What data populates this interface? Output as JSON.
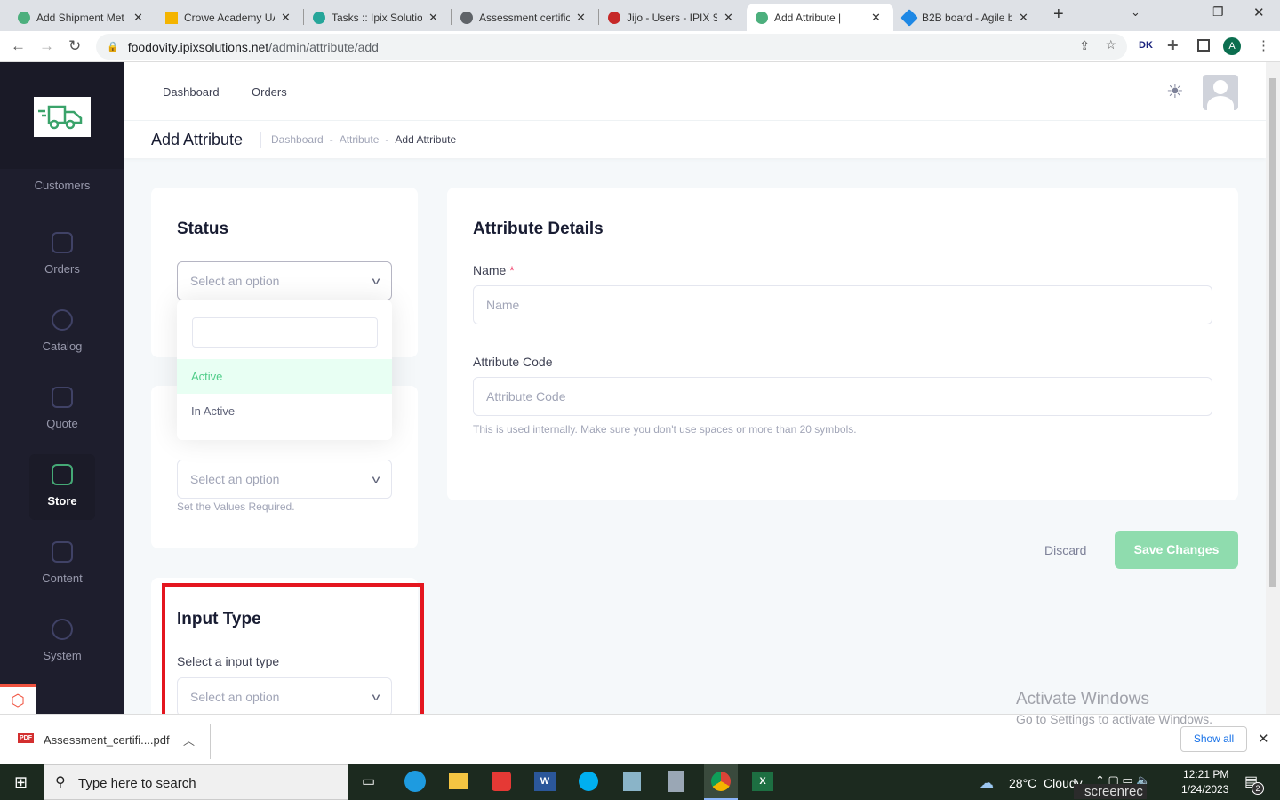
{
  "browser": {
    "tabs": [
      {
        "title": "Add Shipment Met",
        "color": "#4caf7d"
      },
      {
        "title": "Crowe Academy UA",
        "color": "#f4b400"
      },
      {
        "title": "Tasks :: Ipix Solution",
        "color": "#26a69a"
      },
      {
        "title": "Assessment certific",
        "color": "#5f6368"
      },
      {
        "title": "Jijo - Users - IPIX Sc",
        "color": "#c62828"
      },
      {
        "title": "Add Attribute |",
        "color": "#4caf7d"
      },
      {
        "title": "B2B board - Agile b",
        "color": "#1e88e5"
      }
    ],
    "active_tab": 5,
    "url_host": "foodovity.ipixsolutions.net",
    "url_path": "/admin/attribute/add",
    "profile": "A",
    "ext": "DK"
  },
  "sidebar": {
    "items": [
      "Customers",
      "Orders",
      "Catalog",
      "Quote",
      "Store",
      "Content",
      "System"
    ],
    "active": "Store"
  },
  "header": {
    "links": [
      "Dashboard",
      "Orders"
    ]
  },
  "toolbar": {
    "title": "Add Attribute",
    "breadcrumb": [
      "Dashboard",
      "Attribute",
      "Add Attribute"
    ]
  },
  "status_card": {
    "title": "Status",
    "placeholder": "Select an option",
    "search_value": "",
    "options": [
      "Active",
      "In Active"
    ],
    "highlighted": "Active"
  },
  "values_card": {
    "placeholder": "Select an option",
    "hint": "Set the Values Required."
  },
  "input_type_card": {
    "title": "Input Type",
    "label": "Select a input type",
    "placeholder": "Select an option"
  },
  "details": {
    "title": "Attribute Details",
    "name_label": "Name",
    "required_mark": "*",
    "name_placeholder": "Name",
    "code_label": "Attribute Code",
    "code_placeholder": "Attribute Code",
    "code_hint": "This is used internally. Make sure you don't use spaces or more than 20 symbols."
  },
  "actions": {
    "discard": "Discard",
    "save": "Save Changes"
  },
  "watermark": {
    "line1": "Activate Windows",
    "line2": "Go to Settings to activate Windows."
  },
  "download": {
    "file": "Assessment_certifi....pdf",
    "show_all": "Show all"
  },
  "taskbar": {
    "search": "Type here to search",
    "weather": "28°C  Cloudy",
    "time": "12:21 PM",
    "date": "1/24/2023",
    "notifications": "2",
    "recorder": "screenrec"
  },
  "colors": {
    "accent": "#50cd89",
    "highlight_box": "#e4161f"
  }
}
